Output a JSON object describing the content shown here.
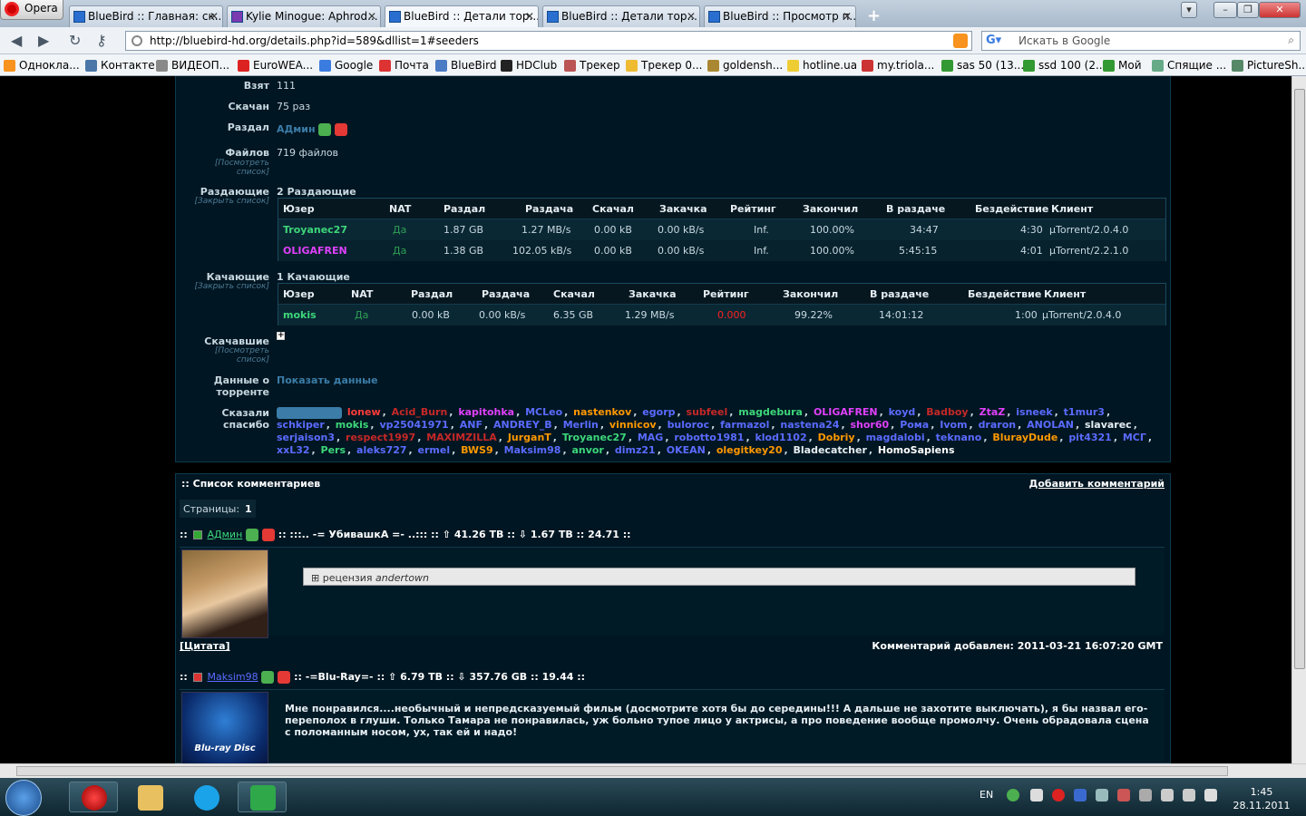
{
  "browser": {
    "opera_label": "Opera",
    "tabs": [
      {
        "title": "BlueBird :: Главная: ск...",
        "active": false
      },
      {
        "title": "Kylie Minogue: Aphrod...",
        "active": false
      },
      {
        "title": "BlueBird :: Детали тор...",
        "active": true
      },
      {
        "title": "BlueBird :: Детали тор...",
        "active": false
      },
      {
        "title": "BlueBird :: Просмотр п...",
        "active": false
      }
    ],
    "url": "http://bluebird-hd.org/details.php?id=589&dllist=1#seeders",
    "search_placeholder": "Искать в Google",
    "bookmarks": [
      "Однокла...",
      "Контакте",
      "ВИДЕОП...",
      "EuroWEA...",
      "Google",
      "Почта",
      "BlueBird",
      "HDClub",
      "Трекер",
      "Трекер 0...",
      "goldensh...",
      "hotline.ua",
      "my.triola...",
      "sas 50 (13...",
      "ssd 100 (2...",
      "Мой",
      "Спящие ...",
      "PictureSh..."
    ]
  },
  "torrent": {
    "taken_label": "Взят",
    "taken_value": "111",
    "downloaded_label": "Скачан",
    "downloaded_value": "75 раз",
    "uploader_label": "Раздал",
    "uploader_value": "АДмин",
    "files_label": "Файлов",
    "files_sub": "[Посмотреть список]",
    "files_value": "719 файлов",
    "seeders_label": "Раздающие",
    "seeders_sub": "[Закрыть список]",
    "seeders_count": "2 Раздающие",
    "leechers_label": "Качающие",
    "leechers_sub": "[Закрыть список]",
    "leechers_count": "1 Качающие",
    "snatchers_label": "Скачавшие",
    "snatchers_sub": "[Посмотреть список]",
    "snatchers_value": "+",
    "torrent_data_label": "Данные о торренте",
    "torrent_data_value": "Показать данные",
    "thanks_label": "Сказали спасибо"
  },
  "seeders_table": {
    "headers": [
      "Юзер",
      "NAT",
      "Раздал",
      "Раздача",
      "Скачал",
      "Закачка",
      "Рейтинг",
      "Закончил",
      "В раздаче",
      "Бездействие",
      "Клиент"
    ],
    "rows": [
      {
        "user": "Troyanec27",
        "color": "#3dd67a",
        "nat": "Да",
        "up": "1.87 GB",
        "upspd": "1.27 MB/s",
        "down": "0.00 kB",
        "downspd": "0.00 kB/s",
        "ratio": "Inf.",
        "done": "100.00%",
        "seeding": "34:47",
        "idle": "4:30",
        "client": "µTorrent/2.0.4.0"
      },
      {
        "user": "OLIGAFREN",
        "color": "#e040fb",
        "nat": "Да",
        "up": "1.38 GB",
        "upspd": "102.05 kB/s",
        "down": "0.00 kB",
        "downspd": "0.00 kB/s",
        "ratio": "Inf.",
        "done": "100.00%",
        "seeding": "5:45:15",
        "idle": "4:01",
        "client": "µTorrent/2.2.1.0"
      }
    ]
  },
  "leechers_table": {
    "headers": [
      "Юзер",
      "NAT",
      "Раздал",
      "Раздача",
      "Скачал",
      "Закачка",
      "Рейтинг",
      "Закончил",
      "В раздаче",
      "Бездействие",
      "Клиент"
    ],
    "rows": [
      {
        "user": "mokis",
        "color": "#3dd67a",
        "nat": "Да",
        "up": "0.00 kB",
        "upspd": "0.00 kB/s",
        "down": "6.35 GB",
        "downspd": "1.29 MB/s",
        "ratio": "0.000",
        "done": "99.22%",
        "seeding": "14:01:12",
        "idle": "1:00",
        "client": "µTorrent/2.0.4.0"
      }
    ]
  },
  "thanks": [
    {
      "n": "lonew",
      "c": "#ff3b3b"
    },
    {
      "n": "Acid_Burn",
      "c": "#c62828"
    },
    {
      "n": "kapitohka",
      "c": "#e040fb"
    },
    {
      "n": "MCLeo",
      "c": "#5b6bff"
    },
    {
      "n": "nastenkov",
      "c": "#ff9800"
    },
    {
      "n": "egorp",
      "c": "#5b6bff"
    },
    {
      "n": "subfeel",
      "c": "#c62828"
    },
    {
      "n": "magdebura",
      "c": "#3dd67a"
    },
    {
      "n": "OLIGAFREN",
      "c": "#e040fb"
    },
    {
      "n": "koyd",
      "c": "#5b6bff"
    },
    {
      "n": "Badboy",
      "c": "#c62828"
    },
    {
      "n": "ZtaZ",
      "c": "#e040fb"
    },
    {
      "n": "isneek",
      "c": "#5b6bff"
    },
    {
      "n": "t1mur3",
      "c": "#5b6bff"
    },
    {
      "n": "schkiper",
      "c": "#5b6bff"
    },
    {
      "n": "mokis",
      "c": "#3dd67a"
    },
    {
      "n": "vp25041971",
      "c": "#5b6bff"
    },
    {
      "n": "ANF",
      "c": "#5b6bff"
    },
    {
      "n": "ANDREY_B",
      "c": "#5b6bff"
    },
    {
      "n": "Merlin",
      "c": "#5b6bff"
    },
    {
      "n": "vinnicov",
      "c": "#ff9800"
    },
    {
      "n": "buloroc",
      "c": "#5b6bff"
    },
    {
      "n": "farmazol",
      "c": "#5b6bff"
    },
    {
      "n": "nastena24",
      "c": "#5b6bff"
    },
    {
      "n": "shor60",
      "c": "#e040fb"
    },
    {
      "n": "Рома",
      "c": "#5b6bff"
    },
    {
      "n": "Ivom",
      "c": "#5b6bff"
    },
    {
      "n": "draron",
      "c": "#5b6bff"
    },
    {
      "n": "ANOLAN",
      "c": "#5b6bff"
    },
    {
      "n": "slavarec",
      "c": "#e6eef2"
    },
    {
      "n": "serjaison3",
      "c": "#5b6bff"
    },
    {
      "n": "respect1997",
      "c": "#c62828"
    },
    {
      "n": "MAXIMZILLA",
      "c": "#c62828"
    },
    {
      "n": "JurganT",
      "c": "#ff9800"
    },
    {
      "n": "Troyanec27",
      "c": "#3dd67a"
    },
    {
      "n": "MAG",
      "c": "#5b6bff"
    },
    {
      "n": "robotto1981",
      "c": "#5b6bff"
    },
    {
      "n": "klod1102",
      "c": "#5b6bff"
    },
    {
      "n": "Dobriy",
      "c": "#ff9800"
    },
    {
      "n": "magdalobi",
      "c": "#5b6bff"
    },
    {
      "n": "teknano",
      "c": "#5b6bff"
    },
    {
      "n": "BlurayDude",
      "c": "#ff9800"
    },
    {
      "n": "pit4321",
      "c": "#5b6bff"
    },
    {
      "n": "МСГ",
      "c": "#5b6bff"
    },
    {
      "n": "xxL32",
      "c": "#5b6bff"
    },
    {
      "n": "Pers",
      "c": "#3dd67a"
    },
    {
      "n": "aleks727",
      "c": "#5b6bff"
    },
    {
      "n": "ermel",
      "c": "#5b6bff"
    },
    {
      "n": "BWS9",
      "c": "#ff9800"
    },
    {
      "n": "Maksim98",
      "c": "#5b6bff"
    },
    {
      "n": "anvor",
      "c": "#3dd67a"
    },
    {
      "n": "dimz21",
      "c": "#5b6bff"
    },
    {
      "n": "OKEAN",
      "c": "#5b6bff"
    },
    {
      "n": "olegitkey20",
      "c": "#ff9800"
    },
    {
      "n": "Bladecatcher",
      "c": "#e6eef2"
    },
    {
      "n": "HomoSapiens",
      "c": "#ffffff"
    }
  ],
  "comments": {
    "title": ":: Список комментариев",
    "add_label": "Добавить комментарий",
    "pages_label": "Страницы:",
    "pages_value": "1",
    "items": [
      {
        "prefix": "::",
        "user": "АДмин",
        "user_color": "#3dd67a",
        "stats": ":: :::.. -= УбивашкА =- ..::: :: ⇧ 41.26 TB :: ⇩ 1.67 TB :: 24.71 ::",
        "spoiler": "рецензия",
        "spoiler_author": "andertown",
        "quote": "[Цитата]",
        "added": "Комментарий добавлен: 2011-03-21 16:07:20 GMT"
      },
      {
        "prefix": "::",
        "user": "Maksim98",
        "user_color": "#5b6bff",
        "stats": ":: -=Blu-Ray=- :: ⇧ 6.79 TB :: ⇩ 357.76 GB :: 19.44 ::",
        "text": "Мне понравился....необычный и непредсказуемый фильм (досмотрите хотя бы до середины!!! А дальше не захотите выключать), я бы назвал его-переполох в глуши. Только Тамара не понравилась, уж больно тупое лицо у актрисы, а про поведение вообще промолчу. Очень обрадовала сцена с поломанным носом, ух, так ей и надо!"
      }
    ]
  },
  "taskbar": {
    "lang": "EN",
    "time": "1:45",
    "date": "28.11.2011"
  }
}
